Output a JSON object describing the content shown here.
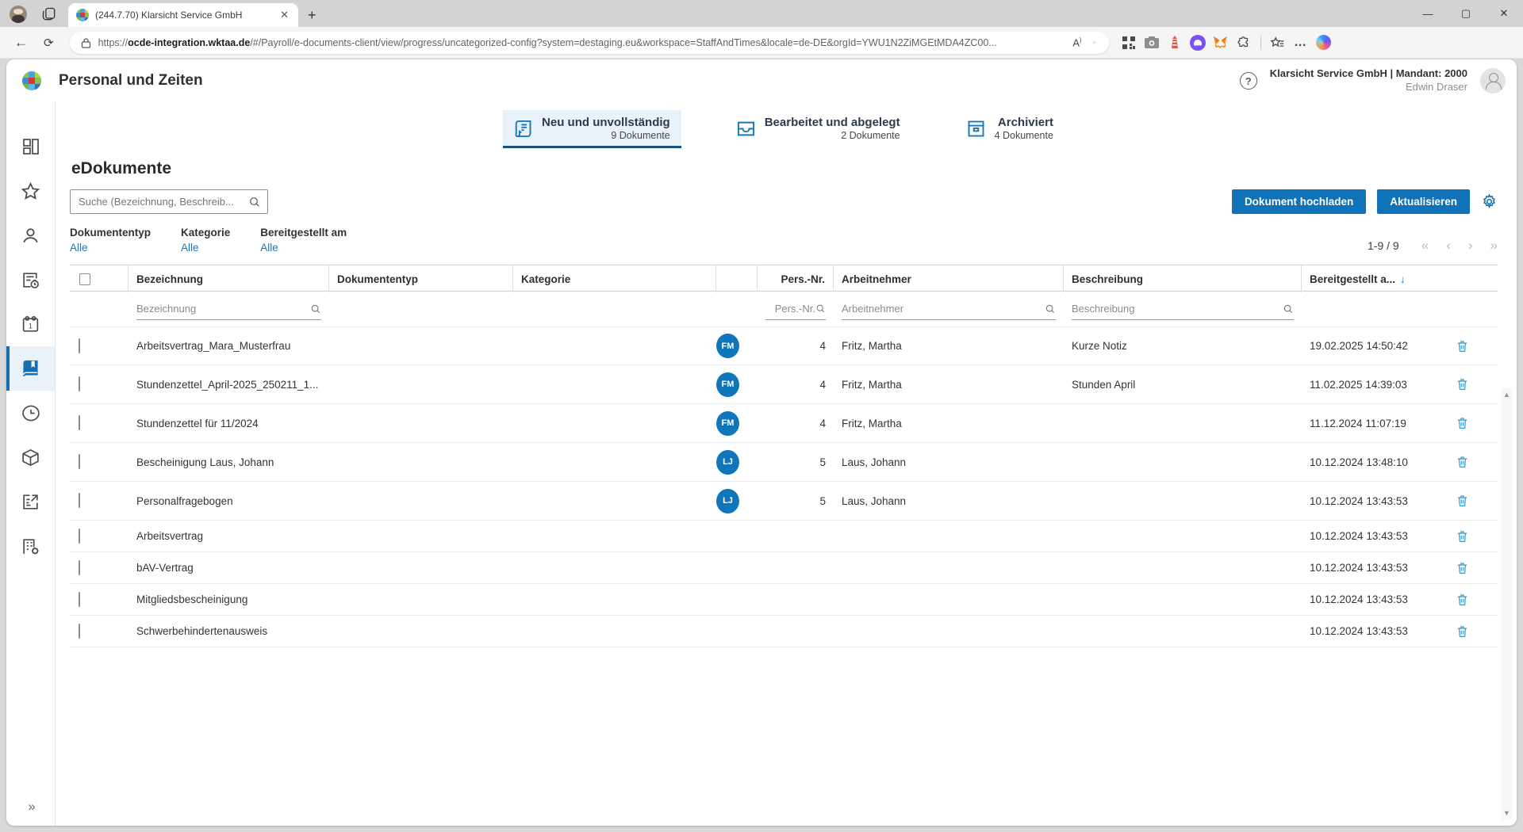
{
  "browser": {
    "tab_title": "(244.7.70) Klarsicht Service GmbH",
    "tab_close": "✕",
    "new_tab": "+",
    "controls": {
      "minimize": "—",
      "maximize": "▢",
      "close": "✕"
    },
    "back": "←",
    "reload": "⟳",
    "url_prefix": "https://",
    "url_host": "ocde-integration.wktaa.de",
    "url_rest": "/#/Payroll/e-documents-client/view/progress/uncategorized-config?system=destaging.eu&workspace=StaffAndTimes&locale=de-DE&orgId=YWU1N2ZiMGEtMDA4ZC00...",
    "read_aloud": "A",
    "extensions": [
      "qr-code",
      "camera",
      "lighthouse",
      "phantom",
      "metamask",
      "extensions-puzzle",
      "favorites-bar",
      "more",
      "copilot"
    ]
  },
  "app": {
    "title": "Personal und Zeiten",
    "tenant_line1": "Klarsicht Service GmbH | Mandant: 2000",
    "tenant_line2": "Edwin Draser",
    "help": "?",
    "sidebar": {
      "items": [
        "dashboard",
        "favorites",
        "employees",
        "time-report",
        "calendar",
        "edocuments",
        "clock",
        "package",
        "export",
        "company-settings"
      ],
      "active": "edocuments",
      "expand": "»"
    },
    "tabs": [
      {
        "label": "Neu und unvollständig",
        "count": "9 Dokumente",
        "active": true
      },
      {
        "label": "Bearbeitet und abgelegt",
        "count": "2 Dokumente",
        "active": false
      },
      {
        "label": "Archiviert",
        "count": "4 Dokumente",
        "active": false
      }
    ],
    "page_title": "eDokumente",
    "search_placeholder": "Suche (Bezeichnung, Beschreib...",
    "buttons": {
      "upload": "Dokument hochladen",
      "refresh": "Aktualisieren"
    },
    "filters": [
      {
        "label": "Dokumententyp",
        "value": "Alle"
      },
      {
        "label": "Kategorie",
        "value": "Alle"
      },
      {
        "label": "Bereitgestellt am",
        "value": "Alle"
      }
    ],
    "pagination": {
      "range": "1-9 / 9",
      "first": "«",
      "prev": "‹",
      "next": "›",
      "last": "»"
    },
    "table": {
      "columns": {
        "bezeichnung": "Bezeichnung",
        "dokumententyp": "Dokumententyp",
        "kategorie": "Kategorie",
        "pers_nr": "Pers.-Nr.",
        "arbeitnehmer": "Arbeitnehmer",
        "beschreibung": "Beschreibung",
        "bereitgestellt": "Bereitgestellt a...",
        "sort_arrow": "↓"
      },
      "filter_placeholders": {
        "bezeichnung": "Bezeichnung",
        "pers_nr": "Pers.-Nr.",
        "arbeitnehmer": "Arbeitnehmer",
        "beschreibung": "Beschreibung"
      },
      "rows": [
        {
          "incomplete": false,
          "bezeichnung": "Arbeitsvertrag_Mara_Musterfrau",
          "dokumententyp": "",
          "kategorie": "",
          "initials": "FM",
          "pers_nr": "4",
          "arbeitnehmer": "Fritz, Martha",
          "beschreibung": "Kurze Notiz",
          "bereitgestellt": "19.02.2025 14:50:42"
        },
        {
          "incomplete": true,
          "bezeichnung": "Stundenzettel_April-2025_250211_1...",
          "dokumententyp": "",
          "kategorie": "",
          "initials": "FM",
          "pers_nr": "4",
          "arbeitnehmer": "Fritz, Martha",
          "beschreibung": "Stunden April",
          "bereitgestellt": "11.02.2025 14:39:03"
        },
        {
          "incomplete": false,
          "bezeichnung": "Stundenzettel für 11/2024",
          "dokumententyp": "",
          "kategorie": "",
          "initials": "FM",
          "pers_nr": "4",
          "arbeitnehmer": "Fritz, Martha",
          "beschreibung": "",
          "bereitgestellt": "11.12.2024 11:07:19"
        },
        {
          "incomplete": false,
          "bezeichnung": "Bescheinigung Laus, Johann",
          "dokumententyp": "",
          "kategorie": "",
          "initials": "LJ",
          "pers_nr": "5",
          "arbeitnehmer": "Laus, Johann",
          "beschreibung": "",
          "bereitgestellt": "10.12.2024 13:48:10"
        },
        {
          "incomplete": false,
          "bezeichnung": "Personalfragebogen",
          "dokumententyp": "",
          "kategorie": "",
          "initials": "LJ",
          "pers_nr": "5",
          "arbeitnehmer": "Laus, Johann",
          "beschreibung": "",
          "bereitgestellt": "10.12.2024 13:43:53"
        },
        {
          "incomplete": true,
          "bezeichnung": "Arbeitsvertrag",
          "dokumententyp": "",
          "kategorie": "",
          "initials": "",
          "pers_nr": "",
          "arbeitnehmer": "",
          "beschreibung": "",
          "bereitgestellt": "10.12.2024 13:43:53"
        },
        {
          "incomplete": true,
          "bezeichnung": "bAV-Vertrag",
          "dokumententyp": "",
          "kategorie": "",
          "initials": "",
          "pers_nr": "",
          "arbeitnehmer": "",
          "beschreibung": "",
          "bereitgestellt": "10.12.2024 13:43:53"
        },
        {
          "incomplete": true,
          "bezeichnung": "Mitgliedsbescheinigung",
          "dokumententyp": "",
          "kategorie": "",
          "initials": "",
          "pers_nr": "",
          "arbeitnehmer": "",
          "beschreibung": "",
          "bereitgestellt": "10.12.2024 13:43:53"
        },
        {
          "incomplete": true,
          "bezeichnung": "Schwerbehindertenausweis",
          "dokumententyp": "",
          "kategorie": "",
          "initials": "",
          "pers_nr": "",
          "arbeitnehmer": "",
          "beschreibung": "",
          "bereitgestellt": "10.12.2024 13:43:53"
        }
      ]
    },
    "colors": {
      "primary": "#1072b9",
      "link": "#1a78bb",
      "active_tab_bg": "#e9f2f9",
      "tab_underline": "#17547d",
      "avatar": "#1076bc",
      "incomplete_dot": "#c13535",
      "trash": "#2e9ad3"
    }
  }
}
